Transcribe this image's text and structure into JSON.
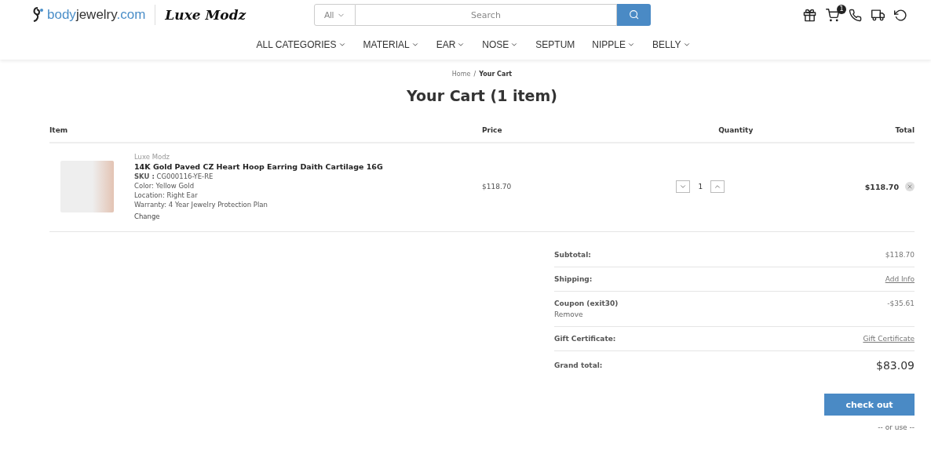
{
  "header": {
    "logo_text": {
      "brand": "body",
      "rest": "jewelry",
      "domain": ".com"
    },
    "sub_brand": "Luxe Modz",
    "search": {
      "scope": "All",
      "placeholder": "Search"
    },
    "cart_count": "1"
  },
  "nav": [
    {
      "label": "ALL CATEGORIES",
      "caret": true
    },
    {
      "label": "MATERIAL",
      "caret": true
    },
    {
      "label": "EAR",
      "caret": true
    },
    {
      "label": "NOSE",
      "caret": true
    },
    {
      "label": "SEPTUM",
      "caret": false
    },
    {
      "label": "NIPPLE",
      "caret": true
    },
    {
      "label": "BELLY",
      "caret": true
    }
  ],
  "breadcrumb": [
    {
      "label": "Home",
      "current": false,
      "separator": "/"
    },
    {
      "label": "Your Cart",
      "current": true
    }
  ],
  "title": "Your Cart (1 item)",
  "table": {
    "columns": [
      "Item",
      "Price",
      "Quantity",
      "Total"
    ],
    "rows": [
      {
        "brand": "Luxe Modz",
        "name": "14K Gold Paved CZ Heart Hoop Earring Daith Cartilage 16G",
        "sku_label": "SKU :",
        "sku": "CG000116-YE-RE",
        "options": [
          "Color: Yellow Gold",
          "Location: Right Ear",
          "Warranty: 4 Year Jewelry Protection Plan"
        ],
        "change": "Change",
        "price": "$118.70",
        "quantity": "1",
        "total": "$118.70"
      }
    ]
  },
  "summary": [
    {
      "kind": "text",
      "label": "Subtotal:",
      "value": "$118.70"
    },
    {
      "kind": "link",
      "label": "Shipping:",
      "value": "Add Info"
    },
    {
      "kind": "coupon",
      "label": "Coupon (exit30)",
      "sub": "Remove",
      "value": "-$35.61"
    },
    {
      "kind": "link",
      "label": "Gift Certificate:",
      "value": "Gift Certificate"
    },
    {
      "kind": "grand",
      "label": "Grand total:",
      "value": "$83.09"
    }
  ],
  "checkout": "check out",
  "or_use": "-- or use --"
}
